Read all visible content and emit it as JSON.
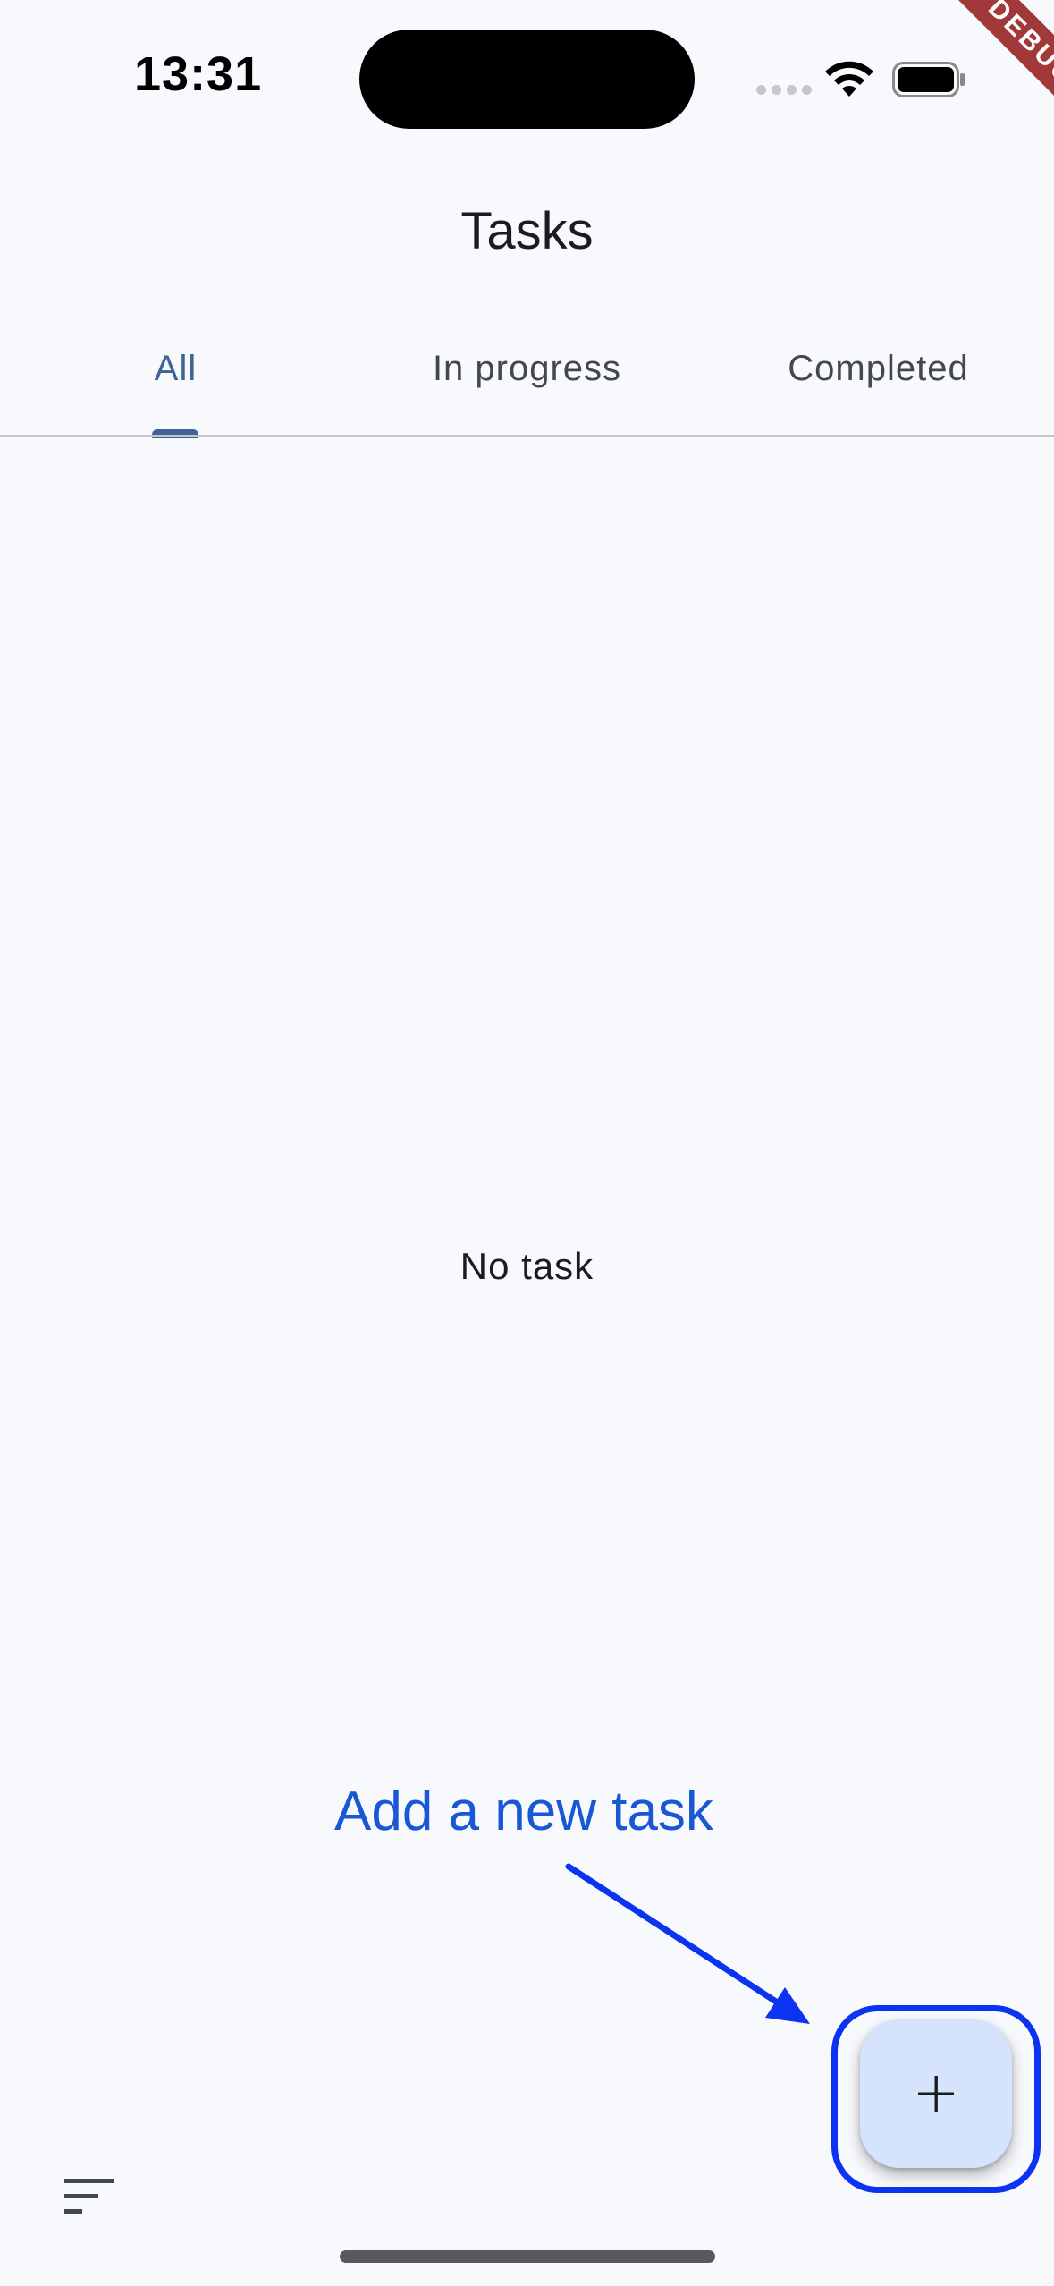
{
  "status_bar": {
    "time": "13:31",
    "icons": [
      "signal-dots-icon",
      "wifi-icon",
      "battery-icon"
    ]
  },
  "debug_banner": "DEBUG",
  "app_bar": {
    "title": "Tasks"
  },
  "tabs": [
    {
      "label": "All",
      "selected": true
    },
    {
      "label": "In progress",
      "selected": false
    },
    {
      "label": "Completed",
      "selected": false
    }
  ],
  "empty_state": {
    "message": "No task"
  },
  "annotation": {
    "text": "Add a new task",
    "color": "#1a57d4",
    "highlight_color": "#0b33f0"
  },
  "fab": {
    "icon": "plus-icon"
  },
  "bottom": {
    "sort_icon": "sort-icon"
  },
  "colors": {
    "accent": "#3f6394",
    "background": "#f7f9fd",
    "fab_background": "#d6e3fc"
  }
}
